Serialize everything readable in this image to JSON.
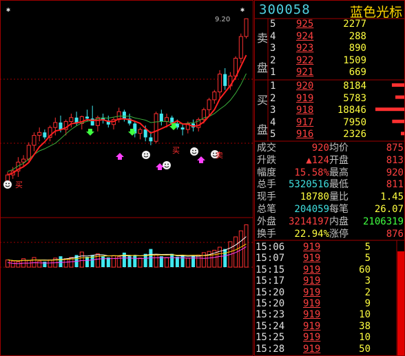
{
  "stock": {
    "code": "300058",
    "name": "蓝色光标"
  },
  "chart": {
    "high_label": "9.20",
    "markers": [
      "买",
      "卖"
    ],
    "candles": [
      [
        7.55,
        7.65,
        7.5,
        7.62
      ],
      [
        7.62,
        7.7,
        7.58,
        7.66
      ],
      [
        7.66,
        7.8,
        7.6,
        7.75
      ],
      [
        7.75,
        7.82,
        7.7,
        7.78
      ],
      [
        7.78,
        7.95,
        7.74,
        7.92
      ],
      [
        7.92,
        8.05,
        7.86,
        8.02
      ],
      [
        8.02,
        8.1,
        7.96,
        8.05
      ],
      [
        8.05,
        8.08,
        7.98,
        8.0
      ],
      [
        8.0,
        8.12,
        7.96,
        8.1
      ],
      [
        8.1,
        8.2,
        8.02,
        8.15
      ],
      [
        8.15,
        8.22,
        8.05,
        8.08
      ],
      [
        8.08,
        8.18,
        8.02,
        8.16
      ],
      [
        8.16,
        8.24,
        8.1,
        8.2
      ],
      [
        8.2,
        8.26,
        8.12,
        8.14
      ],
      [
        8.14,
        8.22,
        8.08,
        8.21
      ],
      [
        8.21,
        8.28,
        8.16,
        8.19
      ],
      [
        8.19,
        8.32,
        8.12,
        8.12
      ],
      [
        8.12,
        8.22,
        8.06,
        8.2
      ],
      [
        8.2,
        8.24,
        8.14,
        8.17
      ],
      [
        8.17,
        8.22,
        8.1,
        8.13
      ],
      [
        8.13,
        8.2,
        8.08,
        8.18
      ],
      [
        8.18,
        8.3,
        8.15,
        8.26
      ],
      [
        8.26,
        8.28,
        8.16,
        8.19
      ],
      [
        8.19,
        8.24,
        8.12,
        8.14
      ],
      [
        8.14,
        8.16,
        8.0,
        8.04
      ],
      [
        8.04,
        8.1,
        7.98,
        8.08
      ],
      [
        8.08,
        8.12,
        7.96,
        8.0
      ],
      [
        8.0,
        8.06,
        7.92,
        7.96
      ],
      [
        7.96,
        8.26,
        7.94,
        8.24
      ],
      [
        8.24,
        8.28,
        8.12,
        8.16
      ],
      [
        8.16,
        8.24,
        8.1,
        8.2
      ],
      [
        8.2,
        8.22,
        8.12,
        8.14
      ],
      [
        8.14,
        8.18,
        8.08,
        8.1
      ],
      [
        8.1,
        8.14,
        8.02,
        8.08
      ],
      [
        8.08,
        8.16,
        8.04,
        8.14
      ],
      [
        8.14,
        8.18,
        8.06,
        8.1
      ],
      [
        8.1,
        8.2,
        8.06,
        8.18
      ],
      [
        8.18,
        8.3,
        8.14,
        8.28
      ],
      [
        8.28,
        8.4,
        8.22,
        8.38
      ],
      [
        8.38,
        8.48,
        8.34,
        8.46
      ],
      [
        8.46,
        8.68,
        8.4,
        8.64
      ],
      [
        8.64,
        8.7,
        8.48,
        8.52
      ],
      [
        8.52,
        8.66,
        8.48,
        8.62
      ],
      [
        8.62,
        8.82,
        8.58,
        8.8
      ],
      [
        8.8,
        9.05,
        8.75,
        9.02
      ],
      [
        9.02,
        9.2,
        9.0,
        9.2
      ]
    ],
    "volumes": [
      12,
      10,
      9,
      14,
      11,
      16,
      10,
      9,
      12,
      15,
      18,
      14,
      16,
      20,
      25,
      17,
      20,
      22,
      18,
      16,
      19,
      17,
      24,
      18,
      20,
      15,
      22,
      30,
      20,
      18,
      16,
      22,
      17,
      20,
      15,
      18,
      20,
      24,
      26,
      28,
      33,
      30,
      42,
      50,
      60,
      70
    ]
  },
  "orderbook": {
    "sell_label": "卖盘",
    "buy_label": "买盘",
    "sells": [
      {
        "lvl": "5",
        "price": "925",
        "vol": "2277"
      },
      {
        "lvl": "4",
        "price": "924",
        "vol": "288"
      },
      {
        "lvl": "3",
        "price": "923",
        "vol": "890"
      },
      {
        "lvl": "2",
        "price": "922",
        "vol": "1509"
      },
      {
        "lvl": "1",
        "price": "921",
        "vol": "669"
      }
    ],
    "buys": [
      {
        "lvl": "1",
        "price": "920",
        "vol": "8184",
        "bar": 0.43
      },
      {
        "lvl": "2",
        "price": "919",
        "vol": "5783",
        "bar": 0.31
      },
      {
        "lvl": "3",
        "price": "918",
        "vol": "18846",
        "bar": 1.0
      },
      {
        "lvl": "4",
        "price": "917",
        "vol": "7950",
        "bar": 0.42
      },
      {
        "lvl": "5",
        "price": "916",
        "vol": "2326",
        "bar": 0.12
      }
    ]
  },
  "stats": {
    "r1": {
      "l1": "成交",
      "v1": "920",
      "l2": "均价",
      "v2": "875"
    },
    "r2": {
      "l1": "升跌",
      "v1": "▲124",
      "l2": "开盘",
      "v2": "813"
    },
    "r3": {
      "l1": "幅度",
      "v1": "15.58%",
      "l2": "最高",
      "v2": "920"
    },
    "r4": {
      "l1": "总手",
      "v1": "5320516",
      "l2": "最低",
      "v2": "811"
    },
    "r5": {
      "l1": "现手",
      "v1": "18780",
      "l2": "量比",
      "v2": "1.45"
    },
    "r6": {
      "l1": "总笔",
      "v1": "204059",
      "l2": "每笔",
      "v2": "26.07"
    },
    "r7": {
      "l1": "外盘",
      "v1": "3214197",
      "l2": "内盘",
      "v2": "2106319"
    },
    "r8": {
      "l1": "换手",
      "v1": "22.94%",
      "l2": "涨停",
      "v2": "876"
    }
  },
  "ticks": [
    {
      "time": "15:06",
      "price": "919",
      "vol": "5"
    },
    {
      "time": "15:07",
      "price": "919",
      "vol": "5"
    },
    {
      "time": "15:15",
      "price": "919",
      "vol": "60"
    },
    {
      "time": "15:17",
      "price": "919",
      "vol": "3"
    },
    {
      "time": "15:20",
      "price": "919",
      "vol": "2"
    },
    {
      "time": "15:20",
      "price": "919",
      "vol": "9"
    },
    {
      "time": "15:23",
      "price": "919",
      "vol": "10"
    },
    {
      "time": "15:24",
      "price": "919",
      "vol": "38"
    },
    {
      "time": "15:25",
      "price": "919",
      "vol": "10"
    },
    {
      "time": "15:28",
      "price": "919",
      "vol": "50"
    }
  ],
  "colors": {
    "up": "#ff3030",
    "down": "#40e8f0",
    "frame": "#a00000",
    "ma5": "#ff2020",
    "ma10": "#40c040"
  }
}
